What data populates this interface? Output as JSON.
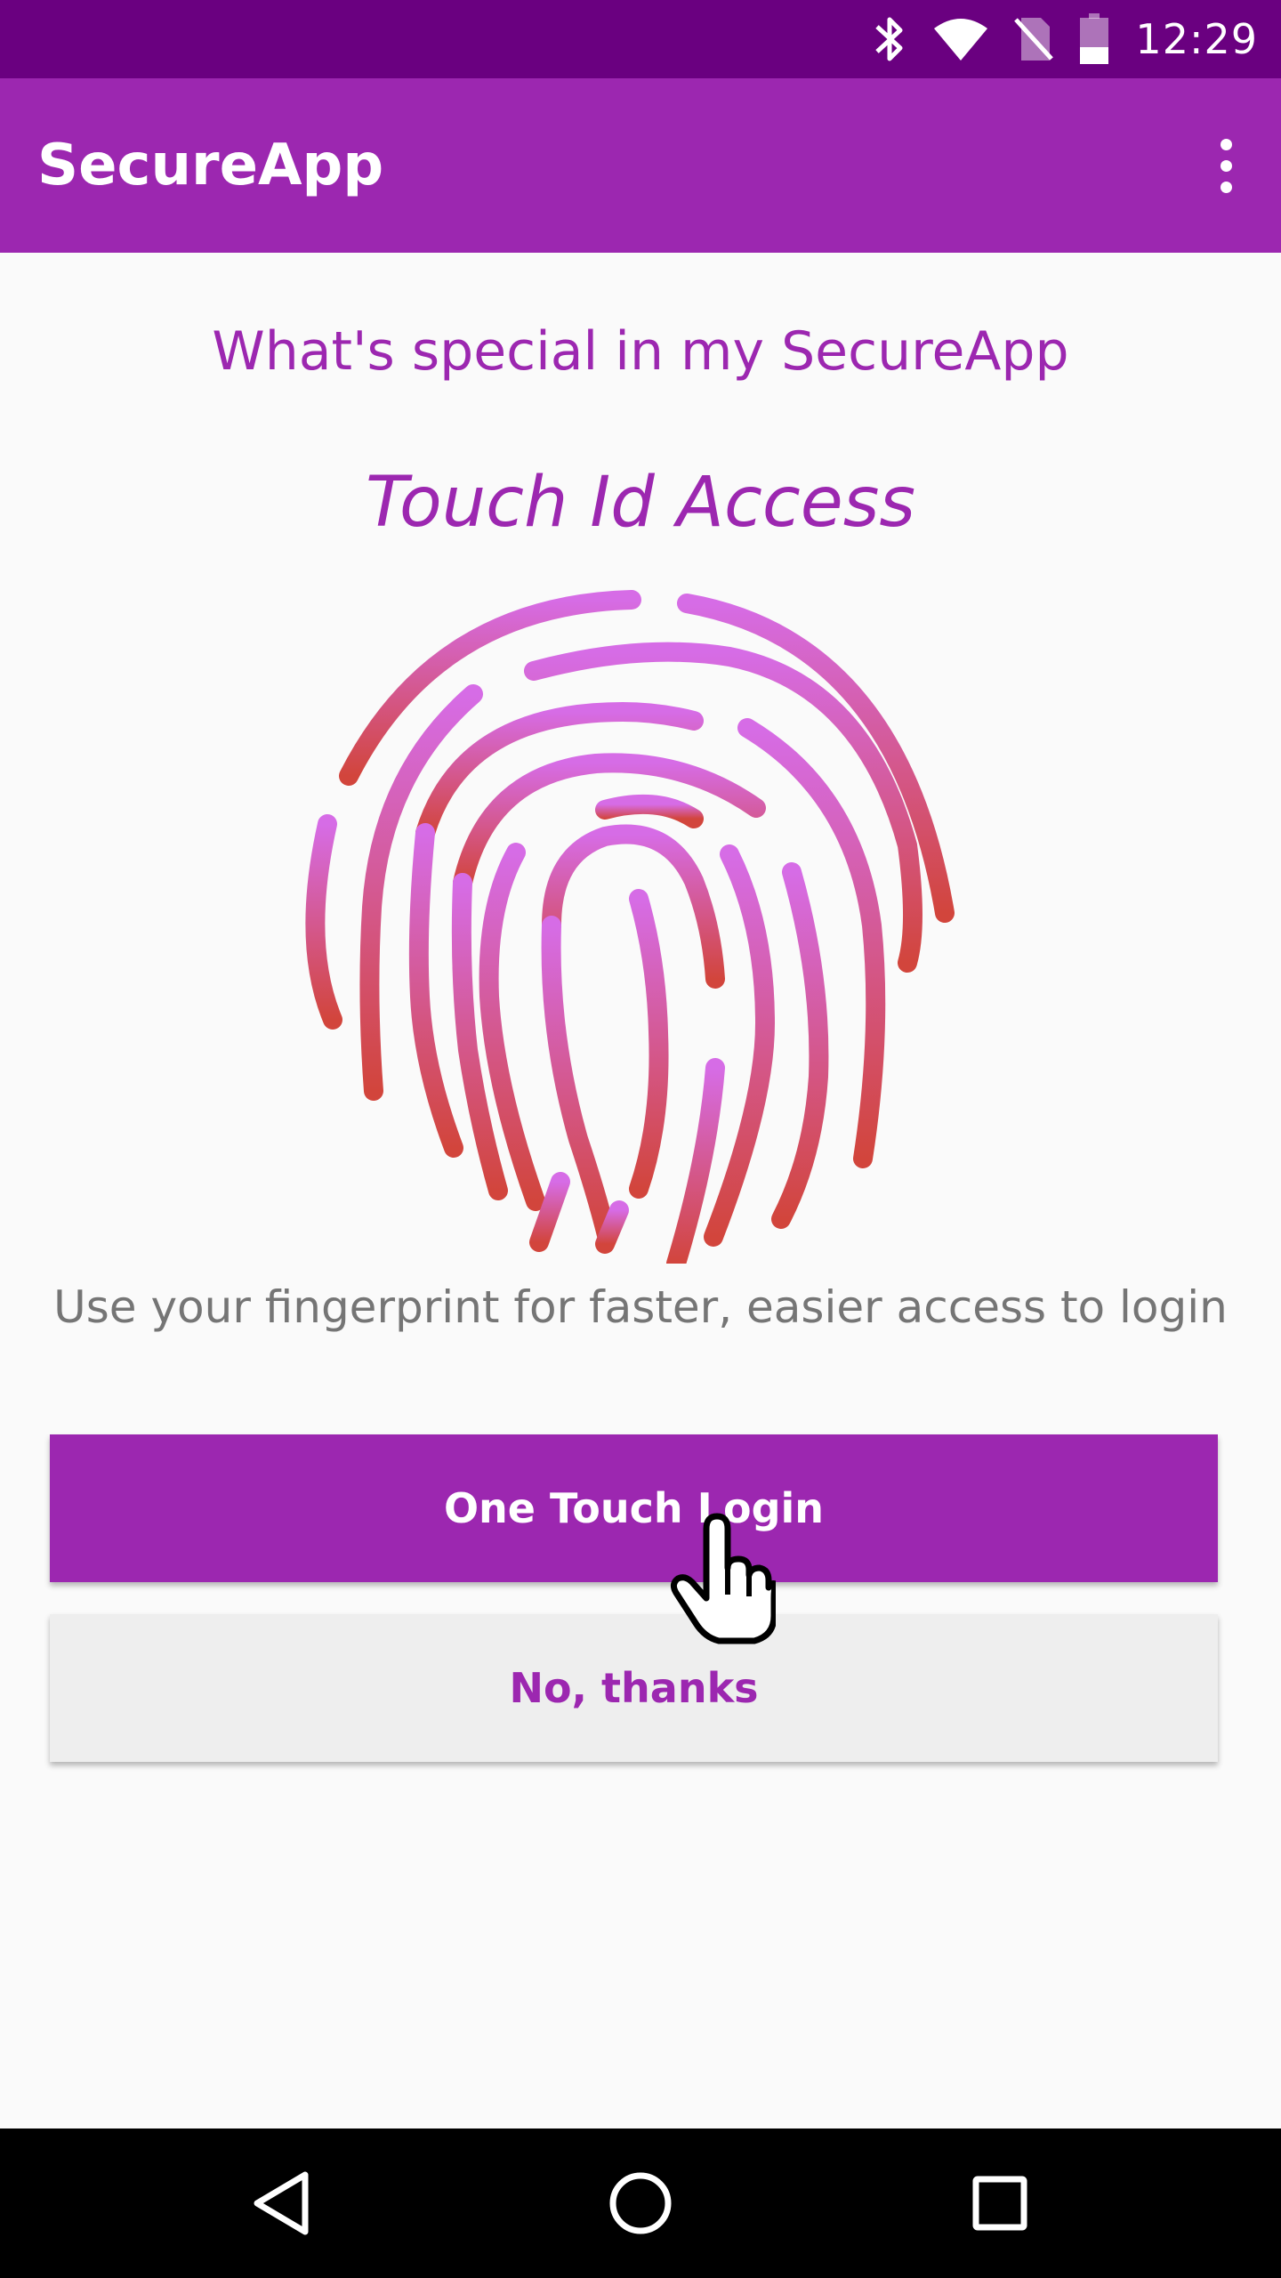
{
  "status_bar": {
    "time": "12:29",
    "icons": [
      "bluetooth-icon",
      "wifi-icon",
      "no-sim-icon",
      "battery-icon"
    ]
  },
  "app_bar": {
    "title": "SecureApp",
    "menu_icon": "more-vert-icon"
  },
  "content": {
    "headline": "What's special in my SecureApp",
    "feature_title": "Touch Id Access",
    "feature_icon": "fingerprint-icon",
    "description": "Use your fingerprint for faster, easier access to login"
  },
  "buttons": {
    "primary_label": "One Touch Login",
    "secondary_label": "No, thanks"
  },
  "cursor": "hand-pointer-icon",
  "nav_bar": {
    "items": [
      "back-icon",
      "home-icon",
      "recents-icon"
    ]
  },
  "colors": {
    "status_bar": "#6a0080",
    "primary": "#9c27b0",
    "fingerprint_top": "#d66ce6",
    "fingerprint_bottom": "#d2453c",
    "secondary_button_bg": "#eeeeee",
    "body_text": "#757575"
  }
}
